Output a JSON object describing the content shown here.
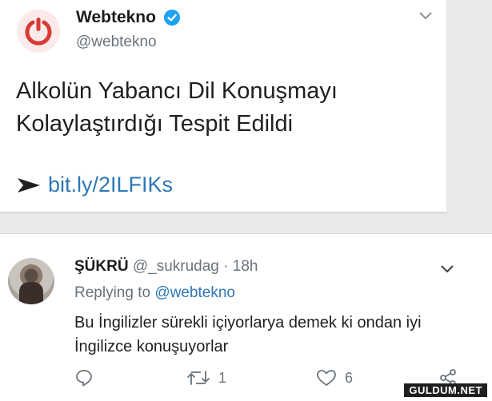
{
  "tweet": {
    "author_name": "Webtekno",
    "author_handle": "@webtekno",
    "text": "Alkolün Yabancı Dil Konuşmayı Kolaylaştırdığı Tespit Edildi",
    "link": "bit.ly/2ILFIKs",
    "logo_color": "#d63b34",
    "verified_color": "#1da1f2"
  },
  "reply": {
    "author_name": "ŞÜKRÜ",
    "author_handle": "@_sukrudag",
    "separator": " · ",
    "time": "18h",
    "replying_prefix": "Replying to",
    "replying_to": "@webtekno",
    "text": "Bu İngilizler sürekli içiyorlarya demek ki ondan iyi İngilizce konuşuyorlar",
    "retweet_count": "1",
    "like_count": "6"
  },
  "watermark": "GULDUM.NET",
  "colors": {
    "link": "#2d77b6",
    "muted": "#6a737c"
  },
  "icons": [
    "power-logo-icon",
    "verified-badge-icon",
    "chevron-down-icon",
    "arrow-icon",
    "reply-icon",
    "retweet-icon",
    "like-icon",
    "share-icon"
  ]
}
